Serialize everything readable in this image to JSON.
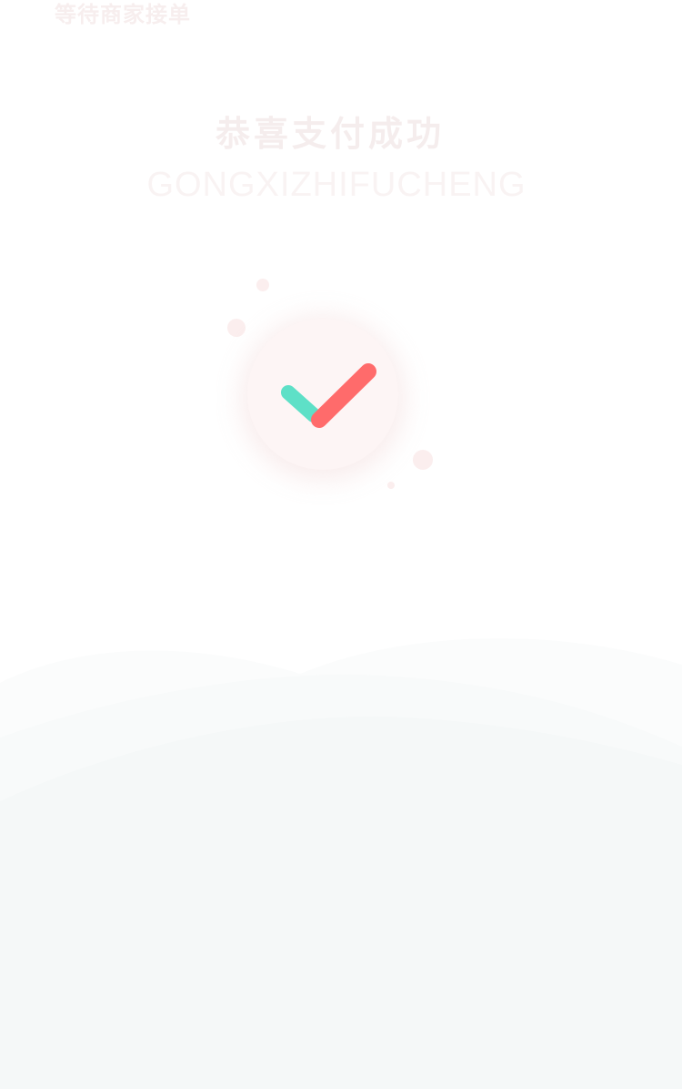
{
  "status": {
    "text": "等待商家接单"
  },
  "result": {
    "title": "恭喜支付成功",
    "subtitle": "GONGXIZHIFUCHENG"
  },
  "icon": {
    "name": "checkmark-icon",
    "short_stroke_color": "#5ee0c7",
    "long_stroke_color": "#ff6b6b",
    "circle_color": "#fdf5f5",
    "dot_color": "#fbeeee"
  },
  "background": {
    "page_color": "#ffffff",
    "wave_color": "#f5f8f8"
  }
}
